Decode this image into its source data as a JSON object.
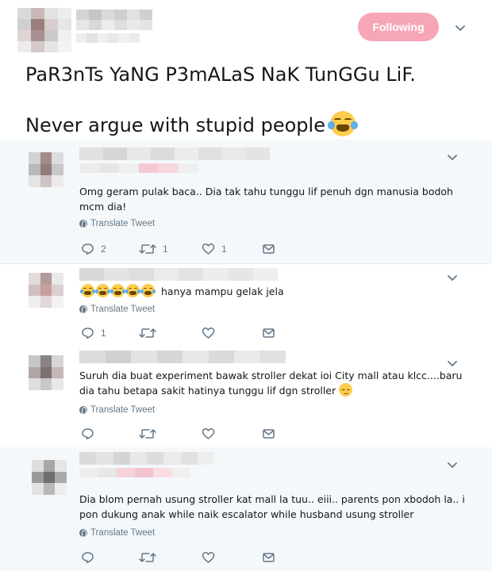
{
  "tweet": {
    "follow_button": "Following",
    "lines": [
      "PaR3nTs YaNG P3mALaS NaK TunGGu LiF.",
      "Never argue with stupid people"
    ],
    "line_emoji": "face-with-tears-of-joy",
    "colors": {
      "follow_bg": "#f6a6b7",
      "text": "#14171a",
      "muted": "#657786",
      "reply_bg": "#f4f8fb"
    }
  },
  "replies": [
    {
      "text": "Omg geram pulak baca.. Dia tak tahu tunggu lif penuh dgn manusia bodoh mcm dia!",
      "translate": "Translate Tweet",
      "reply_count": "2",
      "retweet_count": "1",
      "like_count": "1"
    },
    {
      "text": "hanya mampu gelak jela",
      "emoji_prefix_count": 5,
      "translate": "Translate Tweet",
      "reply_count": "1",
      "retweet_count": "",
      "like_count": ""
    },
    {
      "text": "Suruh dia buat experiment bawak stroller dekat ioi City mall atau klcc....baru dia tahu betapa sakit hatinya tunggu lif dgn stroller",
      "trailing_emoji": "relieved-face",
      "translate": "Translate Tweet",
      "reply_count": "",
      "retweet_count": "",
      "like_count": ""
    },
    {
      "text": "Dia blom pernah usung stroller kat mall la tuu.. eiii.. parents pon xbodoh la.. i pon dukung anak while naik escalator while husband usung stroller",
      "translate": "Translate Tweet",
      "reply_count": "",
      "retweet_count": "",
      "like_count": ""
    }
  ]
}
